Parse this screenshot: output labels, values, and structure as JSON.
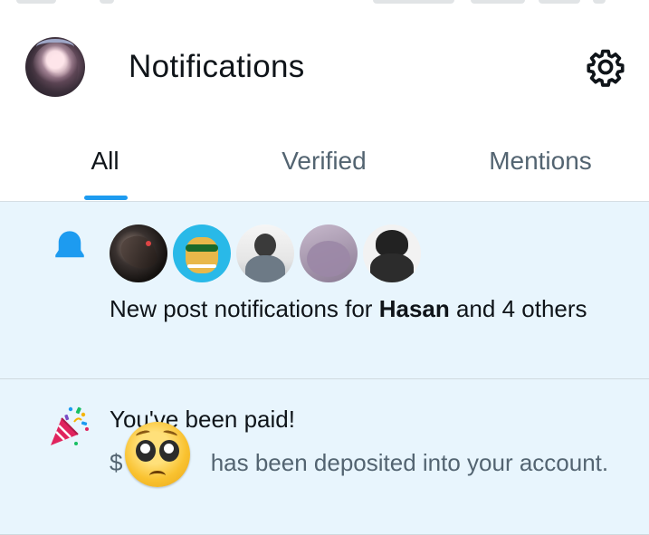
{
  "header": {
    "title": "Notifications"
  },
  "tabs": [
    {
      "label": "All",
      "active": true
    },
    {
      "label": "Verified",
      "active": false
    },
    {
      "label": "Mentions",
      "active": false
    }
  ],
  "notifications": [
    {
      "type": "new-post",
      "icon": "bell-icon",
      "text_prefix": "New post notifications for ",
      "bold_name": "Hasan",
      "text_suffix": " and 4 others"
    },
    {
      "type": "payment",
      "icon": "party-popper-icon",
      "title": "You've been paid!",
      "currency": "$",
      "body_suffix": " has been deposited into your account."
    }
  ],
  "colors": {
    "accent": "#1d9bf0",
    "highlight_bg": "#e8f5fd",
    "text_primary": "#0f1419",
    "text_secondary": "#536471"
  }
}
